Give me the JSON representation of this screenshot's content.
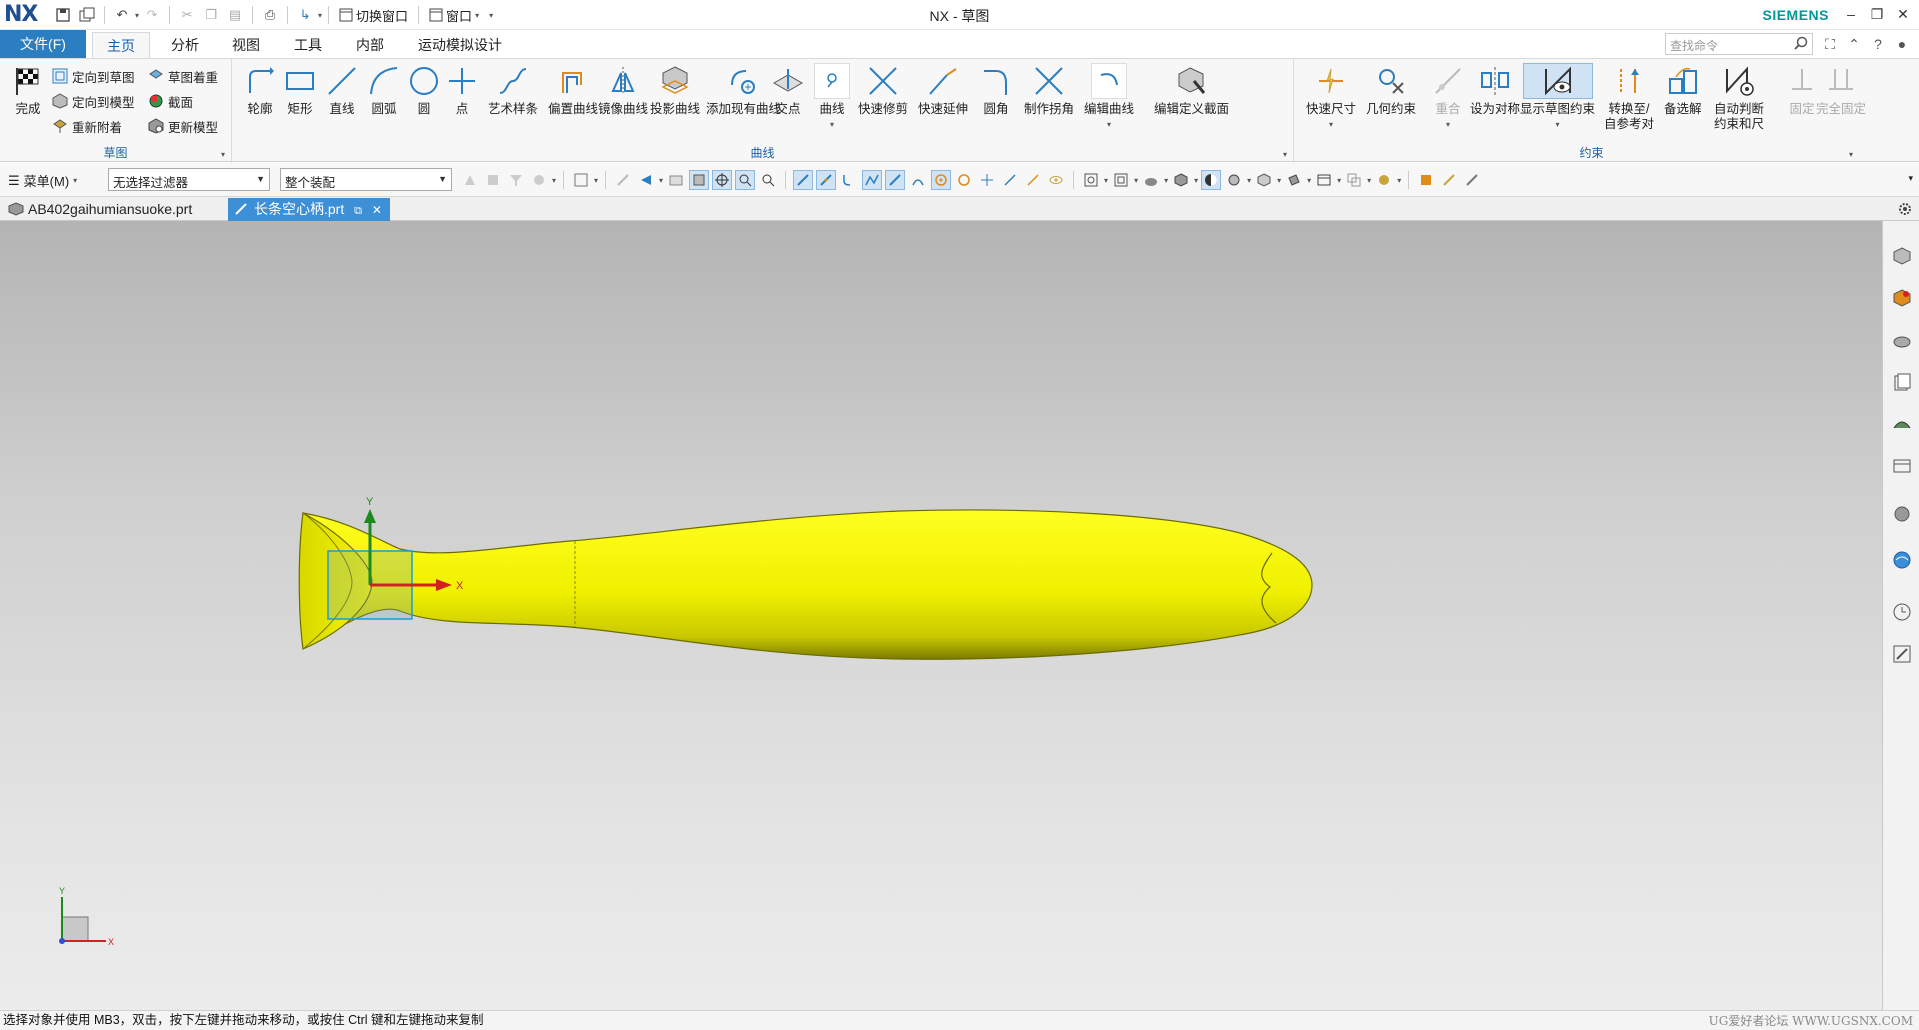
{
  "app": {
    "logo": "NX",
    "window_title": "NX - 草图",
    "brand": "SIEMENS",
    "switch_window": "切换窗口",
    "window_menu": "窗口"
  },
  "tabs": {
    "file": "文件(F)",
    "items": [
      "主页",
      "分析",
      "视图",
      "工具",
      "内部",
      "运动模拟设计"
    ],
    "active": "主页"
  },
  "search": {
    "placeholder": "查找命令"
  },
  "ribbon": {
    "sketch_group": {
      "label": "草图",
      "finish": "完成",
      "orient_to_sketch": "定向到草图",
      "orient_to_model": "定向到模型",
      "reattach": "重新附着",
      "sketch_shade": "草图着重",
      "section": "截面",
      "update_model": "更新模型"
    },
    "curve_group": {
      "label": "曲线",
      "buttons": [
        "轮廓",
        "矩形",
        "直线",
        "圆弧",
        "圆",
        "点",
        "艺术样条",
        "偏置曲线",
        "镜像曲线",
        "投影曲线",
        "添加现有曲线",
        "交点",
        "曲线",
        "快速修剪",
        "快速延伸",
        "圆角",
        "制作拐角",
        "编辑曲线",
        "编辑定义截面"
      ]
    },
    "constraint_group": {
      "label": "约束",
      "quick_dimension": "快速尺寸",
      "geometric_constraints": "几何约束",
      "coincident": "重合",
      "make_symmetric": "设为对称",
      "show_constraints": "显示草图约束",
      "convert_ref_line1": "转换至/",
      "convert_ref_line2": "自参考对",
      "alternate_solution": "备选解",
      "auto_judge_line1": "自动判断",
      "auto_judge_line2": "约束和尺",
      "fixed": "固定",
      "fully_fixed": "完全固定"
    }
  },
  "selection_bar": {
    "menu": "菜单(M)",
    "filter": "无选择过滤器",
    "scope": "整个装配"
  },
  "documents": [
    {
      "name": "AB402gaihumiansuoke.prt",
      "active": false
    },
    {
      "name": "长条空心柄.prt",
      "active": true
    }
  ],
  "viewport": {
    "sketch_axes": {
      "x": "X",
      "y": "Y"
    },
    "triad": {
      "x": "X",
      "y": "Y"
    },
    "colors": {
      "handle": "#f5f500",
      "handle_edge": "#6b6b00",
      "x_axis": "#d42020",
      "y_axis": "#1c8a1c",
      "sketch_box": "#1a9cd8"
    }
  },
  "status": {
    "message": "选择对象并使用 MB3，双击，按下左键并拖动来移动，或按住 Ctrl 键和左键拖动来复制",
    "watermark": "UG爱好者论坛 WWW.UGSNX.COM"
  }
}
